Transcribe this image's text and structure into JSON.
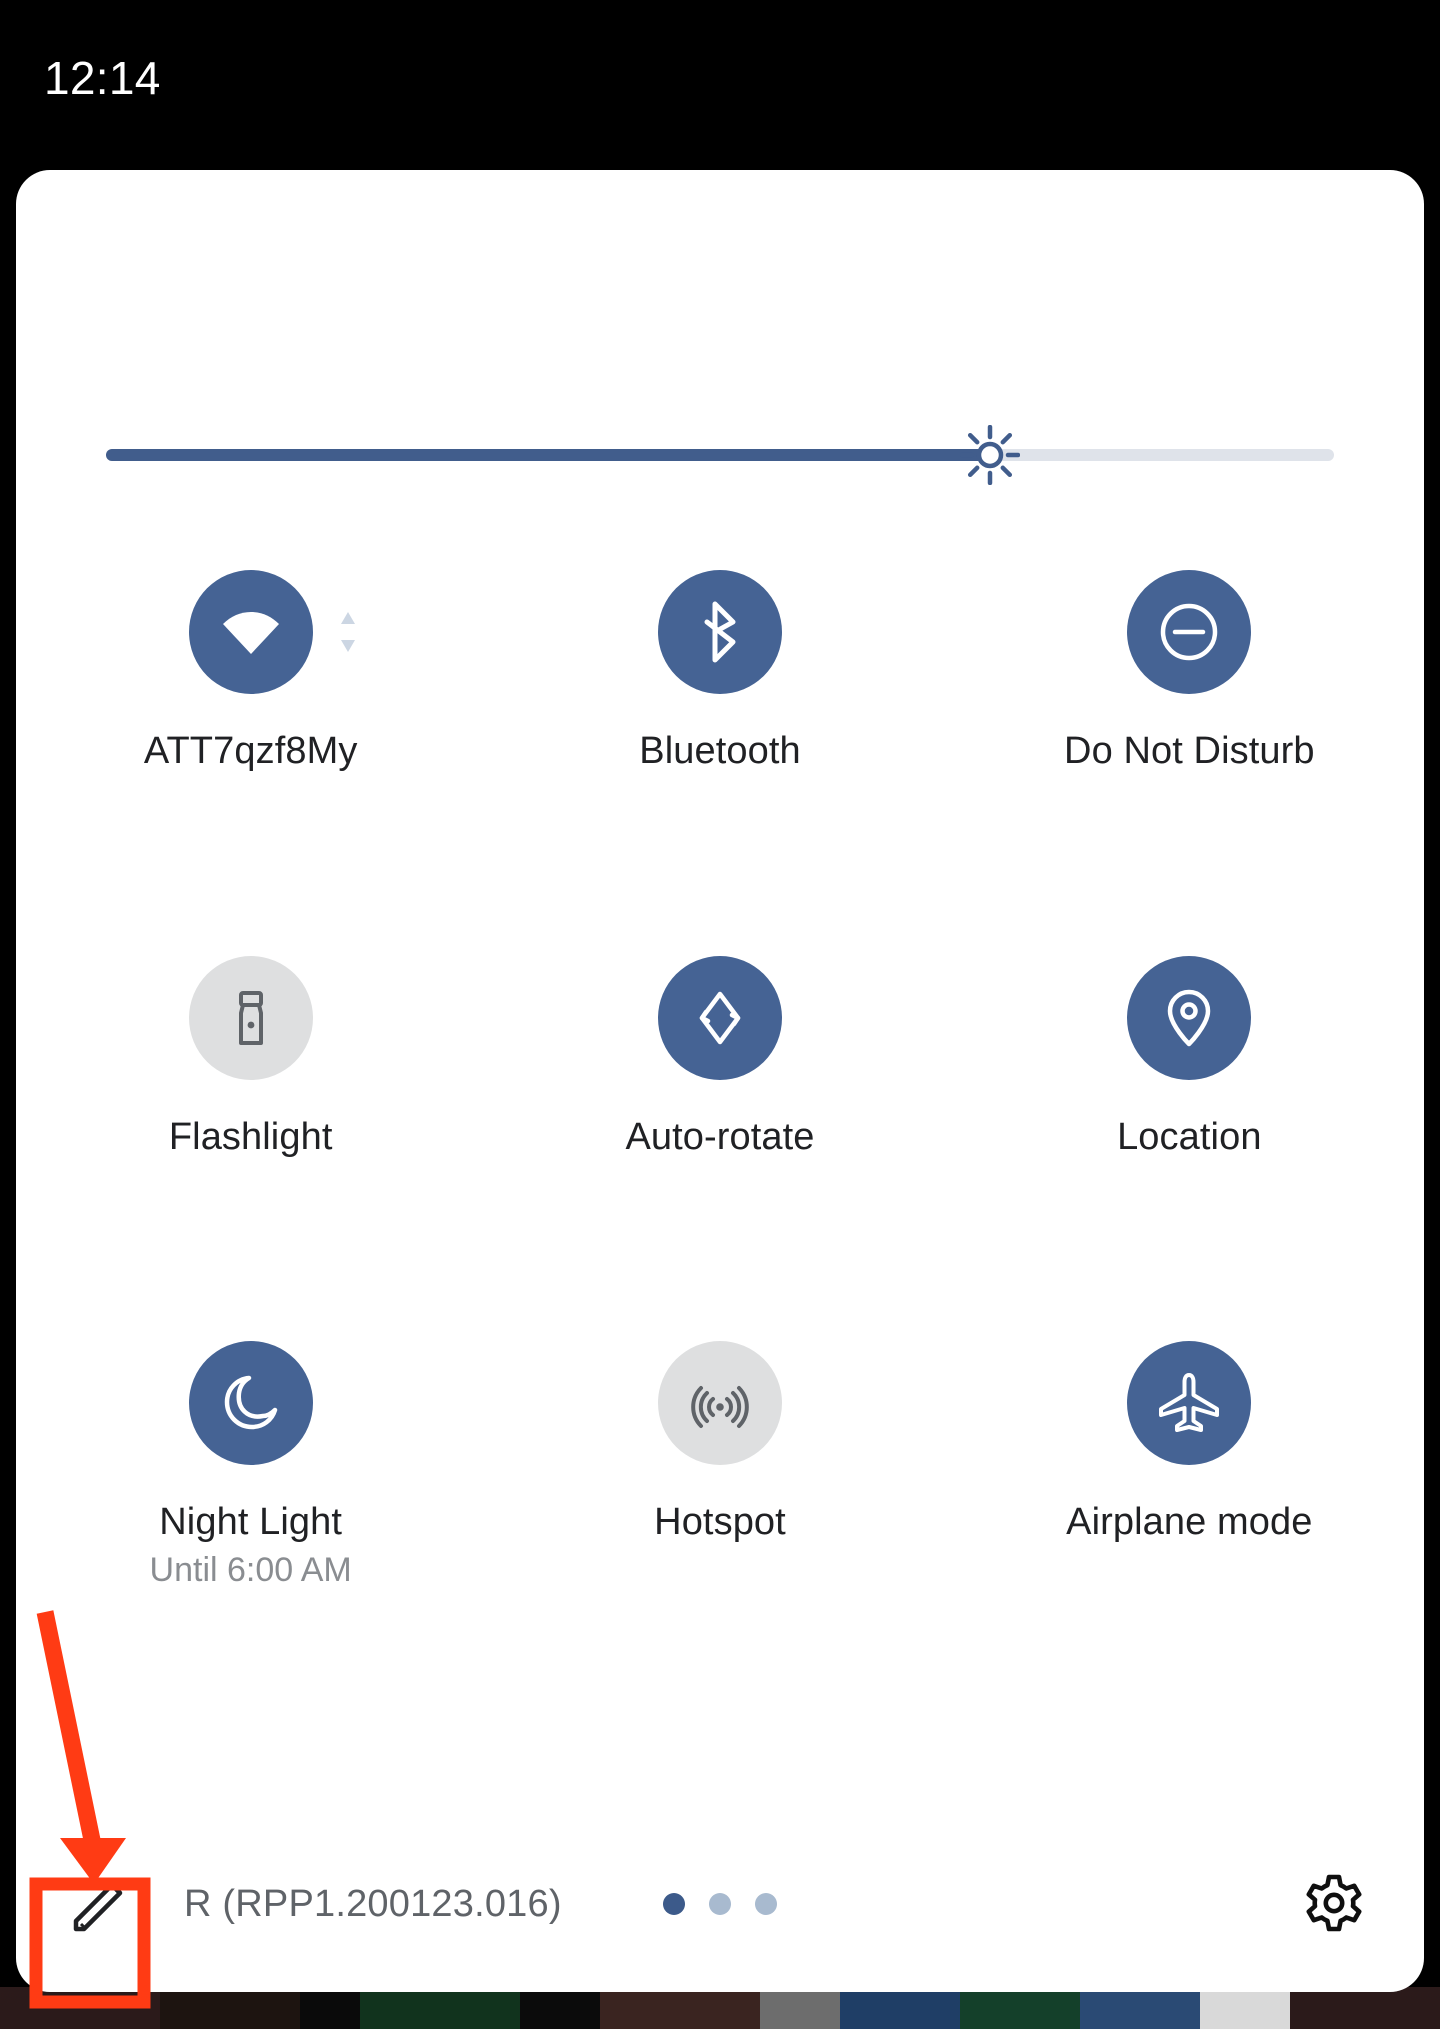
{
  "status_bar": {
    "clock": "12:14"
  },
  "brightness": {
    "name": "brightness-slider",
    "value_percent": 72,
    "icon": "brightness-sun-icon"
  },
  "tiles": [
    {
      "id": "wifi",
      "label": "ATT7qzf8My",
      "sub": "",
      "icon": "wifi-icon",
      "state": "on",
      "has_expand": true
    },
    {
      "id": "bluetooth",
      "label": "Bluetooth",
      "sub": "",
      "icon": "bluetooth-icon",
      "state": "on",
      "has_expand": false
    },
    {
      "id": "do-not-disturb",
      "label": "Do Not Disturb",
      "sub": "",
      "icon": "do-not-disturb-icon",
      "state": "on",
      "has_expand": false
    },
    {
      "id": "flashlight",
      "label": "Flashlight",
      "sub": "",
      "icon": "flashlight-icon",
      "state": "off",
      "has_expand": false
    },
    {
      "id": "auto-rotate",
      "label": "Auto-rotate",
      "sub": "",
      "icon": "auto-rotate-icon",
      "state": "on",
      "has_expand": false
    },
    {
      "id": "location",
      "label": "Location",
      "sub": "",
      "icon": "location-pin-icon",
      "state": "on",
      "has_expand": false
    },
    {
      "id": "night-light",
      "label": "Night Light",
      "sub": "Until 6:00 AM",
      "icon": "moon-icon",
      "state": "on",
      "has_expand": false
    },
    {
      "id": "hotspot",
      "label": "Hotspot",
      "sub": "",
      "icon": "hotspot-icon",
      "state": "off",
      "has_expand": false
    },
    {
      "id": "airplane-mode",
      "label": "Airplane mode",
      "sub": "",
      "icon": "airplane-icon",
      "state": "on",
      "has_expand": false
    }
  ],
  "footer": {
    "edit_icon": "pencil-edit-icon",
    "build_label": "R (RPP1.200123.016)",
    "settings_icon": "gear-icon",
    "page_dots": {
      "total": 3,
      "active_index": 0
    }
  },
  "annotation": {
    "arrow_color": "#FF3B14",
    "highlight_color": "#FF3B14",
    "target": "edit-button"
  },
  "colors": {
    "tile_on": "#456394",
    "tile_off": "#dedfe0",
    "accent": "#415d8c",
    "label": "#202124",
    "sub_label": "#8a8d91",
    "panel_bg": "#ffffff",
    "status_bg": "#000000"
  }
}
